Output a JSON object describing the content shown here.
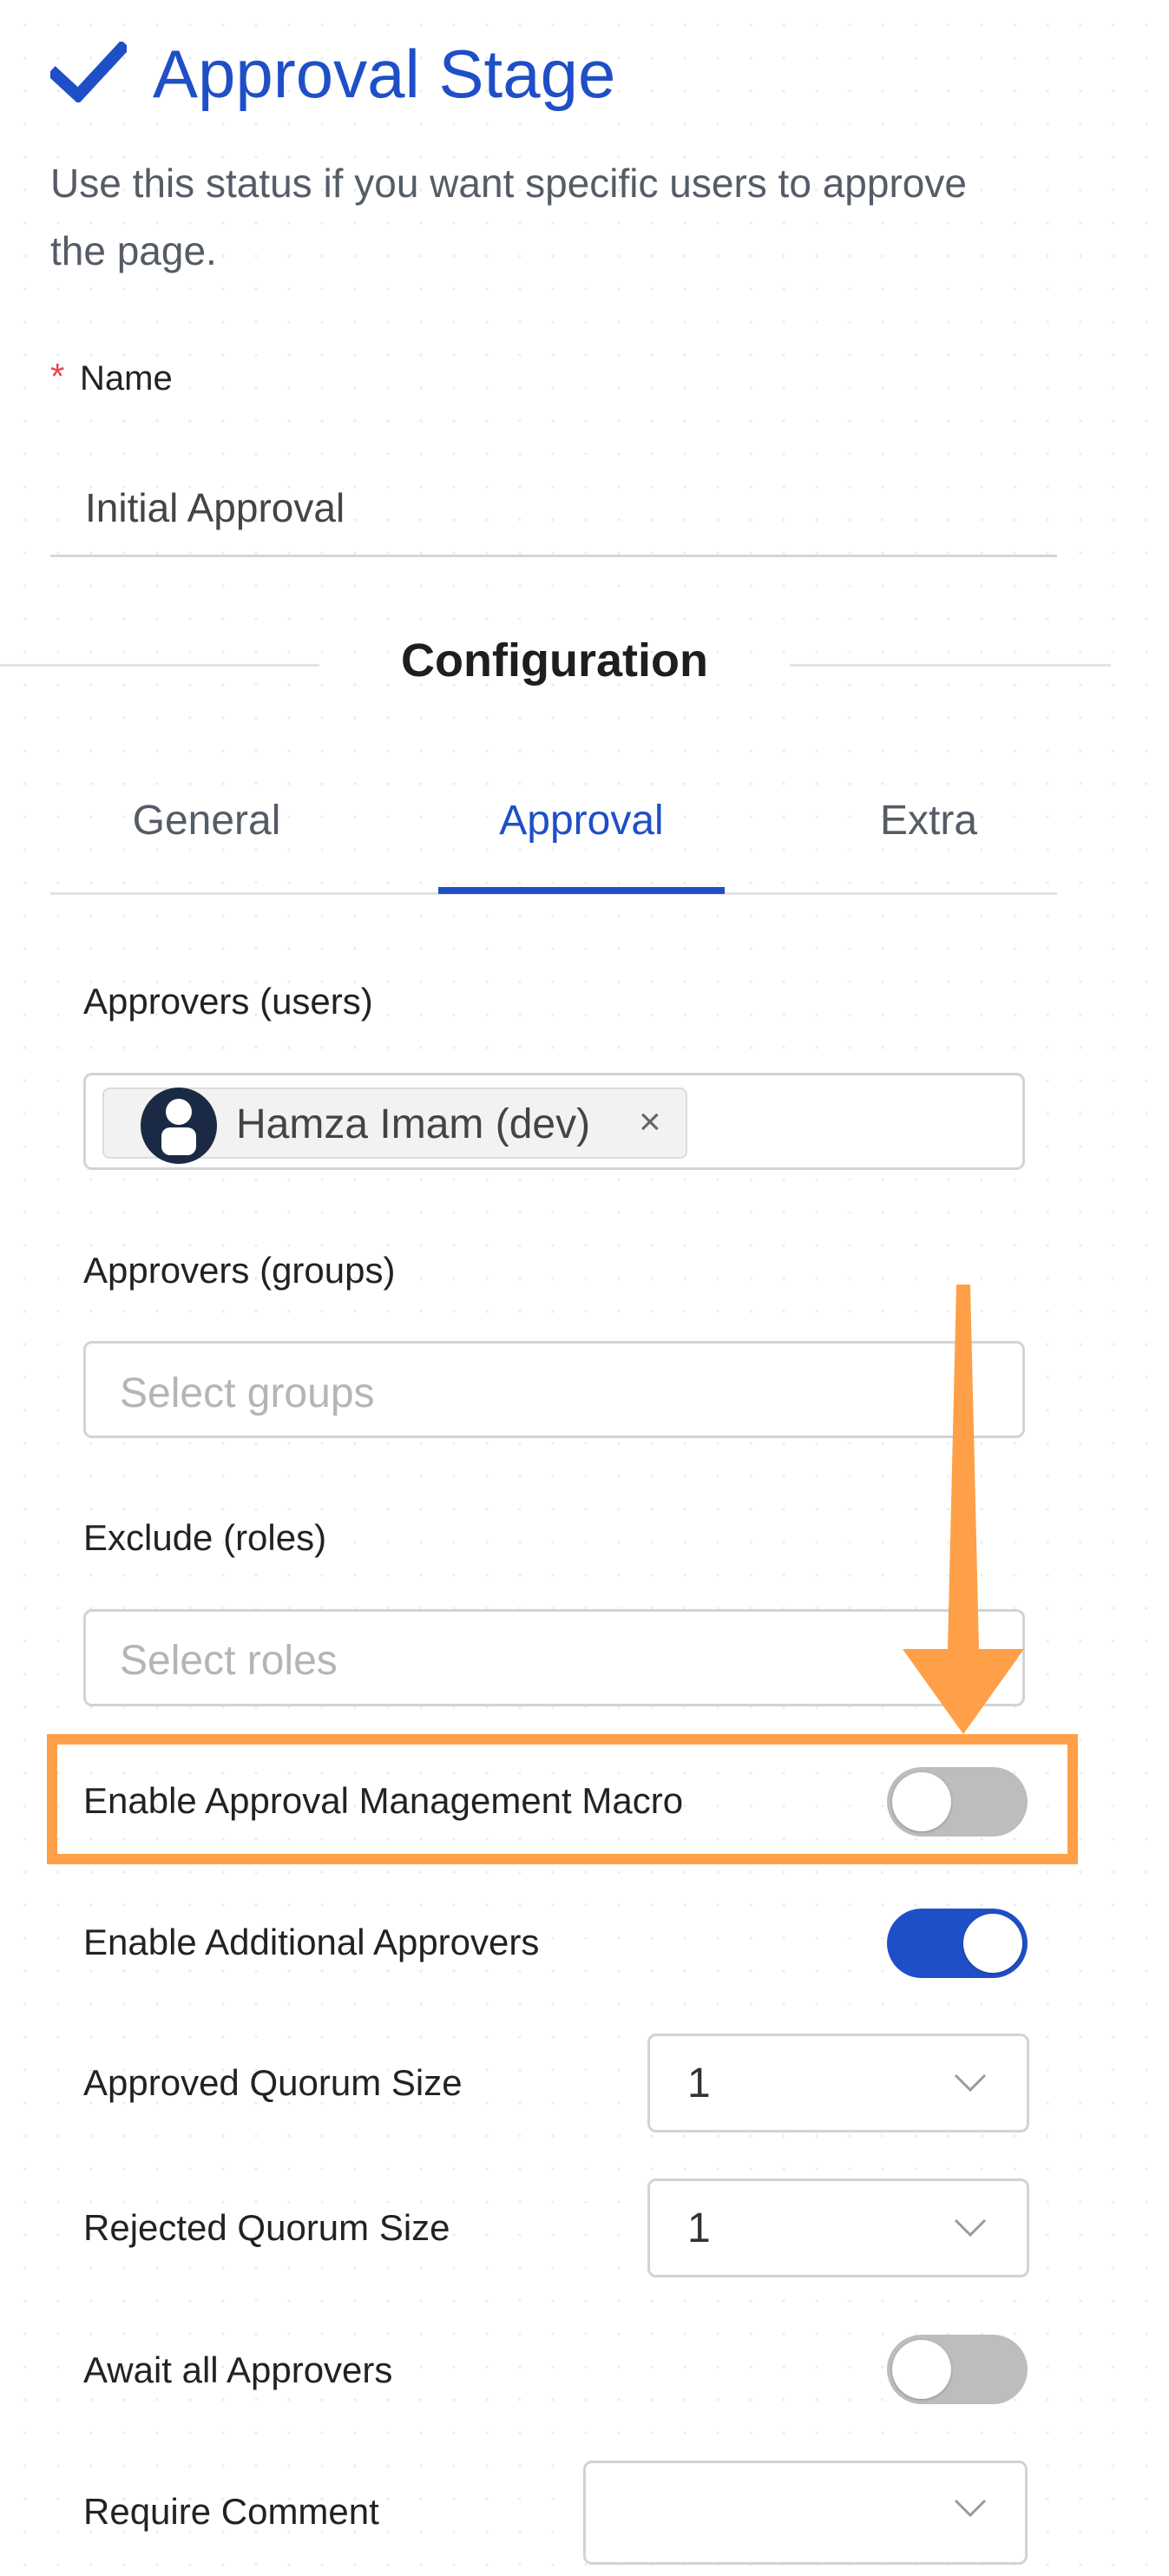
{
  "header": {
    "title": "Approval Stage",
    "description": "Use this status if you want specific users to approve the page."
  },
  "name_field": {
    "required_mark": "*",
    "label": "Name",
    "value": "Initial Approval"
  },
  "configuration": {
    "title": "Configuration",
    "tabs": [
      {
        "label": "General",
        "active": false
      },
      {
        "label": "Approval",
        "active": true
      },
      {
        "label": "Extra",
        "active": false
      }
    ]
  },
  "approvers_users": {
    "label": "Approvers (users)",
    "selected": [
      {
        "name": "Hamza Imam (dev)",
        "remove": "×"
      }
    ]
  },
  "approvers_groups": {
    "label": "Approvers (groups)",
    "placeholder": "Select groups"
  },
  "exclude_roles": {
    "label": "Exclude (roles)",
    "placeholder": "Select roles"
  },
  "toggles": {
    "approval_management_macro": {
      "label": "Enable Approval Management Macro",
      "enabled": false
    },
    "additional_approvers": {
      "label": "Enable Additional Approvers",
      "enabled": true
    },
    "await_all_approvers": {
      "label": "Await all Approvers",
      "enabled": false
    }
  },
  "quorum": {
    "approved": {
      "label": "Approved Quorum Size",
      "value": "1"
    },
    "rejected": {
      "label": "Rejected Quorum Size",
      "value": "1"
    }
  },
  "require_comment": {
    "label": "Require Comment",
    "value": ""
  },
  "colors": {
    "accent": "#1f4fc7",
    "highlight": "#ff9f47",
    "toggle_off": "#bdbdbd",
    "required": "#e5484d"
  },
  "icons": {
    "title": "checkmark-icon",
    "avatar": "user-avatar-icon",
    "remove": "close-icon",
    "select": "chevron-down-icon",
    "annotation": "arrow-down-icon"
  }
}
